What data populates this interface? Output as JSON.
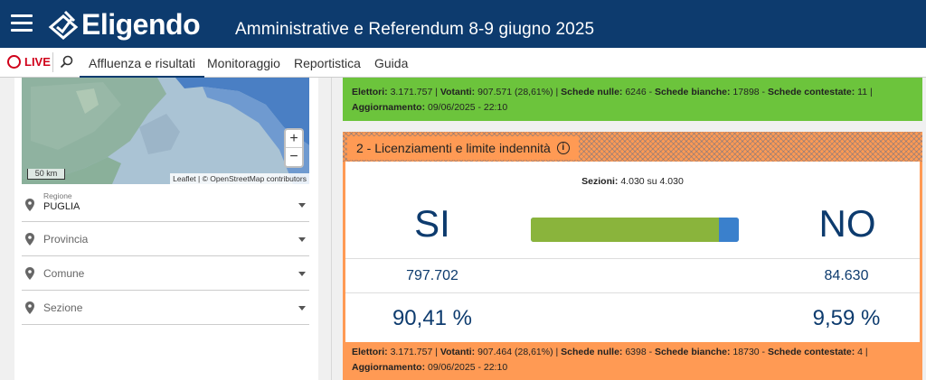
{
  "header": {
    "app_name": "Eligendo",
    "election_title": "Amministrative e Referendum 8-9 giugno 2025"
  },
  "nav": {
    "live_label": "LIVE",
    "items": [
      {
        "label": "Affluenza e risultati",
        "active": true
      },
      {
        "label": "Monitoraggio",
        "active": false
      },
      {
        "label": "Reportistica",
        "active": false
      },
      {
        "label": "Guida",
        "active": false
      }
    ]
  },
  "map": {
    "zoom_in": "+",
    "zoom_out": "−",
    "scale_label": "50 km",
    "attribution": "Leaflet | © OpenStreetMap contributors"
  },
  "filters": {
    "regione": {
      "small_label": "Regione",
      "value": "PUGLIA"
    },
    "provincia": {
      "label": "Provincia"
    },
    "comune": {
      "label": "Comune"
    },
    "sezione": {
      "label": "Sezione"
    }
  },
  "prev_quesito": {
    "elettori_label": "Elettori:",
    "elettori": "3.171.757",
    "votanti_label": "Votanti:",
    "votanti": "907.571 (28,61%)",
    "nulle_label": "Schede nulle:",
    "nulle": "6246",
    "bianche_label": "Schede bianche:",
    "bianche": "17898",
    "contestate_label": "Schede contestate:",
    "contestate": "11",
    "aggiornamento_label": "Aggiornamento:",
    "aggiornamento": "09/06/2025 - 22:10"
  },
  "quesito": {
    "title": "2 - Licenziamenti e limite indennità",
    "info_icon": "i",
    "sezioni_label": "Sezioni:",
    "sezioni": "4.030 su 4.030",
    "yes_label": "SI",
    "no_label": "NO",
    "yes_votes": "797.702",
    "no_votes": "84.630",
    "yes_pct": "90,41 %",
    "no_pct": "9,59 %",
    "yes_fraction": 0.9041,
    "no_fraction": 0.0959,
    "elettori_label": "Elettori:",
    "elettori": "3.171.757",
    "votanti_label": "Votanti:",
    "votanti": "907.464 (28,61%)",
    "nulle_label": "Schede nulle:",
    "nulle": "6398",
    "bianche_label": "Schede bianche:",
    "bianche": "18730",
    "contestate_label": "Schede contestate:",
    "contestate": "4",
    "aggiornamento_label": "Aggiornamento:",
    "aggiornamento": "09/06/2025 - 22:10"
  },
  "colors": {
    "header_bg": "#0d3b6e",
    "yes_bar": "#8ab43c",
    "no_bar": "#3a80cc",
    "prev_band": "#6cc43c",
    "card_bg": "#ff9a54",
    "live_red": "#d0021b"
  }
}
